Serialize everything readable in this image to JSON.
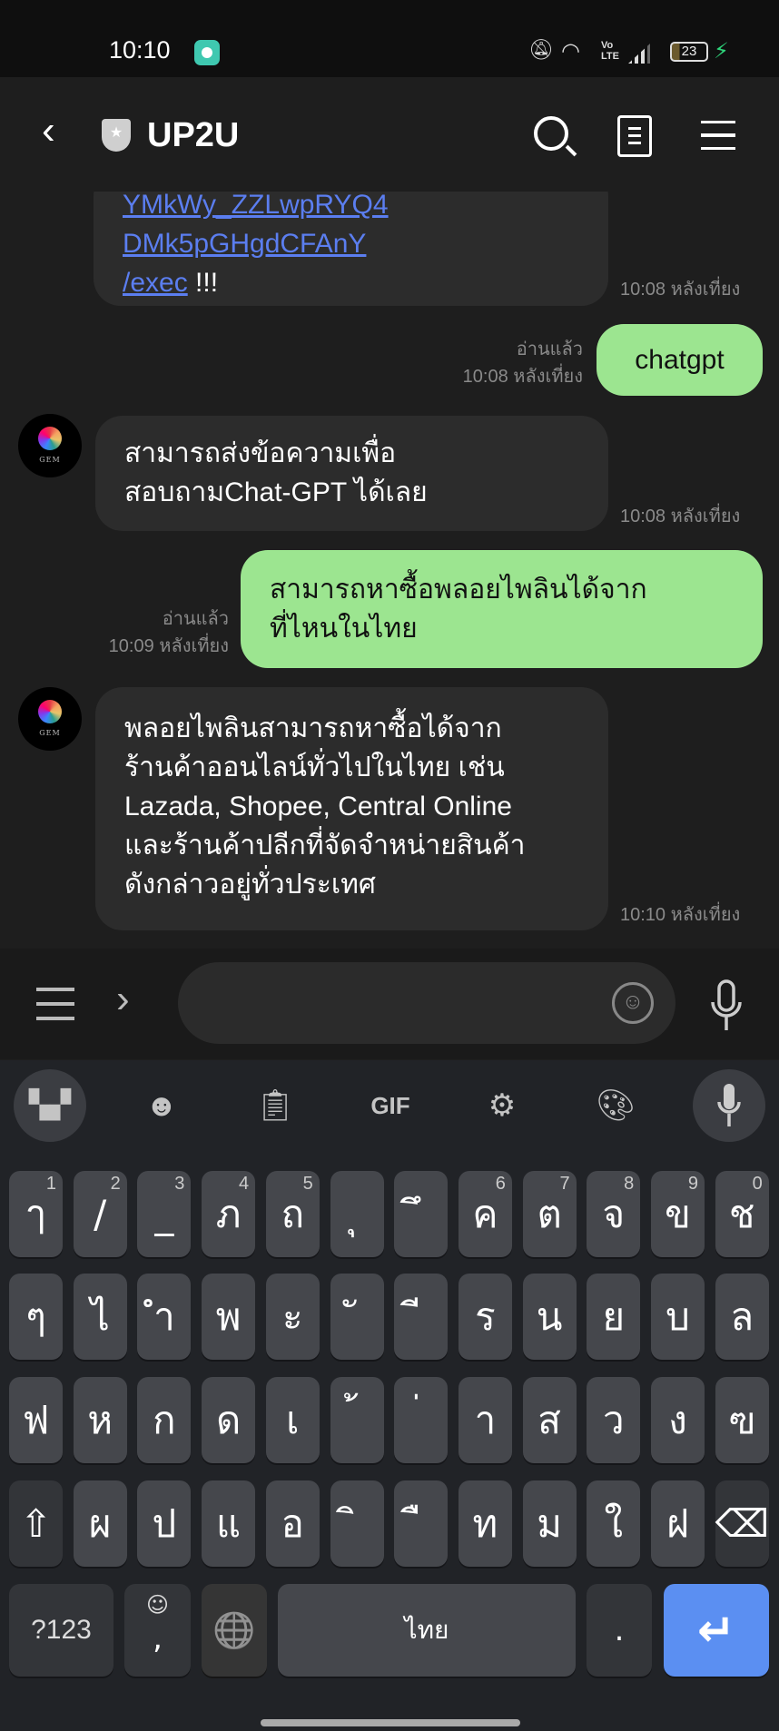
{
  "status_bar": {
    "time": "10:10",
    "battery": "23",
    "icons": [
      "bell-off-icon",
      "wifi-icon",
      "volte-icon",
      "signal-icon",
      "battery-icon",
      "charging-icon"
    ],
    "volte": "Vo LTE"
  },
  "header": {
    "title": "UP2U",
    "back": "back-icon",
    "icons": [
      "search-history-icon",
      "notes-icon",
      "menu-icon"
    ]
  },
  "messages": [
    {
      "side": "in",
      "partial_line": "YMkWy_ZZLwpRYQ4",
      "link_line1": "DMk5pGHgdCFAnY",
      "link_line2": "/exec",
      "suffix": " !!!",
      "time": "10:08 หลังเที่ยง"
    },
    {
      "side": "out",
      "text": "chatgpt",
      "read": "อ่านแล้ว",
      "time": "10:08 หลังเที่ยง"
    },
    {
      "side": "in",
      "lines": [
        "สามารถส่งข้อความเพื่อ",
        "สอบถามChat-GPT ได้เลย"
      ],
      "time": "10:08 หลังเที่ยง",
      "avatar": "GEM"
    },
    {
      "side": "out",
      "lines": [
        "สามารถหาซื้อพลอยไพลินได้จาก",
        "ที่ไหนในไทย"
      ],
      "read": "อ่านแล้ว",
      "time": "10:09 หลังเที่ยง"
    },
    {
      "side": "in",
      "lines": [
        "พลอยไพลินสามารถหาซื้อได้จาก",
        "ร้านค้าออนไลน์ทั่วไปในไทย เช่น",
        "Lazada, Shopee, Central Online",
        "และร้านค้าปลีกที่จัดจำหน่ายสินค้า",
        "ดังกล่าวอยู่ทั่วประเทศ"
      ],
      "time": "10:10 หลังเที่ยง",
      "avatar": "GEM"
    }
  ],
  "input": {
    "value": "",
    "emoji_icon": "☺"
  },
  "keyboard": {
    "toolbar": {
      "gif": "GIF"
    },
    "rows": [
      {
        "keys": [
          "ๅ",
          "/",
          "_",
          "ภ",
          "ถ",
          "ุ",
          "ึ",
          "ค",
          "ต",
          "จ",
          "ข",
          "ช"
        ],
        "hints": [
          "1",
          "2",
          "3",
          "4",
          "5",
          "",
          "",
          "6",
          "7",
          "8",
          "9",
          "0"
        ]
      },
      {
        "keys": [
          "ๆ",
          "ไ",
          "ำ",
          "พ",
          "ะ",
          "ั",
          "ี",
          "ร",
          "น",
          "ย",
          "บ",
          "ล"
        ]
      },
      {
        "keys": [
          "ฟ",
          "ห",
          "ก",
          "ด",
          "เ",
          "้",
          "่",
          "า",
          "ส",
          "ว",
          "ง",
          "ฃ"
        ]
      },
      {
        "keys": [
          "⇧",
          "ผ",
          "ป",
          "แ",
          "อ",
          "ิ",
          "ื",
          "ท",
          "ม",
          "ใ",
          "ฝ",
          "⌫"
        ]
      }
    ],
    "bottom": {
      "symbols": "?123",
      "emoji": "☺",
      "comma": ",",
      "globe": "🌐",
      "space": "ไทย",
      "period": ".",
      "enter": "↵"
    },
    "accent": "#5b8ff2"
  }
}
